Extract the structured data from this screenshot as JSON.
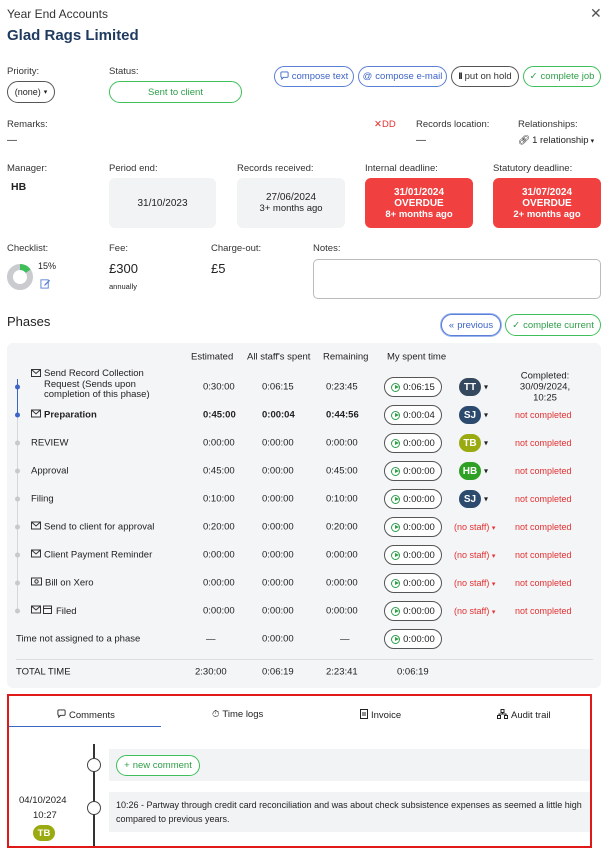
{
  "header": {
    "section": "Year End Accounts",
    "client": "Glad Rags Limited"
  },
  "priority": {
    "label": "Priority:",
    "value": "(none)"
  },
  "status": {
    "label": "Status:",
    "value": "Sent to client"
  },
  "actions": {
    "compose_text": "compose text",
    "compose_email": "compose e-mail",
    "put_on_hold": "put on hold",
    "complete_job": "complete job"
  },
  "remarks": {
    "label": "Remarks:",
    "value": "—"
  },
  "dd": "DD",
  "records_location": {
    "label": "Records location:",
    "value": "—"
  },
  "relationships": {
    "label": "Relationships:",
    "value": "1 relationship"
  },
  "manager": {
    "label": "Manager:",
    "value": "HB"
  },
  "period_end": {
    "label": "Period end:",
    "value": "31/10/2023"
  },
  "records_received": {
    "label": "Records received:",
    "value": "27/06/2024",
    "sub": "3+ months ago"
  },
  "internal_deadline": {
    "label": "Internal deadline:",
    "value": "31/01/2024",
    "status": "OVERDUE",
    "sub": "8+ months ago"
  },
  "statutory_deadline": {
    "label": "Statutory deadline:",
    "value": "31/07/2024",
    "status": "OVERDUE",
    "sub": "2+ months ago"
  },
  "checklist": {
    "label": "Checklist:",
    "percent_text": "15%",
    "percent": 15
  },
  "fee": {
    "label": "Fee:",
    "value": "£300",
    "sub": "annually"
  },
  "charge_out": {
    "label": "Charge-out:",
    "value": "£5"
  },
  "notes": {
    "label": "Notes:"
  },
  "phases": {
    "title": "Phases",
    "previous": "previous",
    "complete_current": "complete current",
    "columns": {
      "estimated": "Estimated",
      "all_staff": "All staff's spent",
      "remaining": "Remaining",
      "my_spent": "My spent time"
    },
    "rows": [
      {
        "name": "Send Record Collection Request (Sends upon completion of this phase)",
        "icon": "mail-icon",
        "estimated": "0:30:00",
        "all_staff": "0:06:15",
        "remaining": "0:23:45",
        "my_spent": "0:06:15",
        "staff": "TT",
        "staff_color": "#34495e",
        "status": "Completed:",
        "status_date": "30/09/2024, 10:25",
        "active": true
      },
      {
        "name": "Preparation",
        "icon": "mail-icon",
        "bold": true,
        "estimated": "0:45:00",
        "all_staff": "0:00:04",
        "remaining": "0:44:56",
        "my_spent": "0:00:04",
        "staff": "SJ",
        "staff_color": "#2c4a6e",
        "status": "not completed",
        "active": true
      },
      {
        "name": "REVIEW",
        "icon": "",
        "estimated": "0:00:00",
        "all_staff": "0:00:00",
        "remaining": "0:00:00",
        "my_spent": "0:00:00",
        "staff": "TB",
        "staff_color": "#9aab12",
        "status": "not completed"
      },
      {
        "name": "Approval",
        "icon": "",
        "estimated": "0:45:00",
        "all_staff": "0:00:00",
        "remaining": "0:45:00",
        "my_spent": "0:00:00",
        "staff": "HB",
        "staff_color": "#2ea024",
        "status": "not completed"
      },
      {
        "name": "Filing",
        "icon": "",
        "estimated": "0:10:00",
        "all_staff": "0:00:00",
        "remaining": "0:10:00",
        "my_spent": "0:00:00",
        "staff": "SJ",
        "staff_color": "#2c4a6e",
        "status": "not completed"
      },
      {
        "name": "Send to client for approval",
        "icon": "mail-icon",
        "estimated": "0:20:00",
        "all_staff": "0:00:00",
        "remaining": "0:20:00",
        "my_spent": "0:00:00",
        "staff": "(no staff)",
        "status": "not completed"
      },
      {
        "name": "Client Payment Reminder",
        "icon": "mail-icon",
        "estimated": "0:00:00",
        "all_staff": "0:00:00",
        "remaining": "0:00:00",
        "my_spent": "0:00:00",
        "staff": "(no staff)",
        "status": "not completed"
      },
      {
        "name": "Bill on Xero",
        "icon": "money-icon",
        "estimated": "0:00:00",
        "all_staff": "0:00:00",
        "remaining": "0:00:00",
        "my_spent": "0:00:00",
        "staff": "(no staff)",
        "status": "not completed"
      },
      {
        "name": "Filed",
        "icon": "mail-calendar-icon",
        "estimated": "0:00:00",
        "all_staff": "0:00:00",
        "remaining": "0:00:00",
        "my_spent": "0:00:00",
        "staff": "(no staff)",
        "status": "not completed"
      }
    ],
    "unassigned": {
      "name": "Time not assigned to a phase",
      "estimated": "—",
      "all_staff": "0:00:00",
      "remaining": "—",
      "my_spent": "0:00:00"
    },
    "total": {
      "name": "TOTAL TIME",
      "estimated": "2:30:00",
      "all_staff": "0:06:19",
      "remaining": "2:23:41",
      "my_spent": "0:06:19"
    }
  },
  "tabs": {
    "comments": "Comments",
    "time_logs": "Time logs",
    "invoice": "Invoice",
    "audit_trail": "Audit trail"
  },
  "comments": {
    "new_comment": "new comment",
    "items": [
      {
        "date": "04/10/2024",
        "time": "10:27",
        "author": "TB",
        "text": "10:26 - Partway through credit card reconciliation and was about check subsistence expenses as seemed a little high compared to previous years."
      }
    ]
  },
  "colors": {
    "accent_blue": "#3d64c7",
    "accent_green": "#2e9e48",
    "overdue_red": "#f14040"
  }
}
